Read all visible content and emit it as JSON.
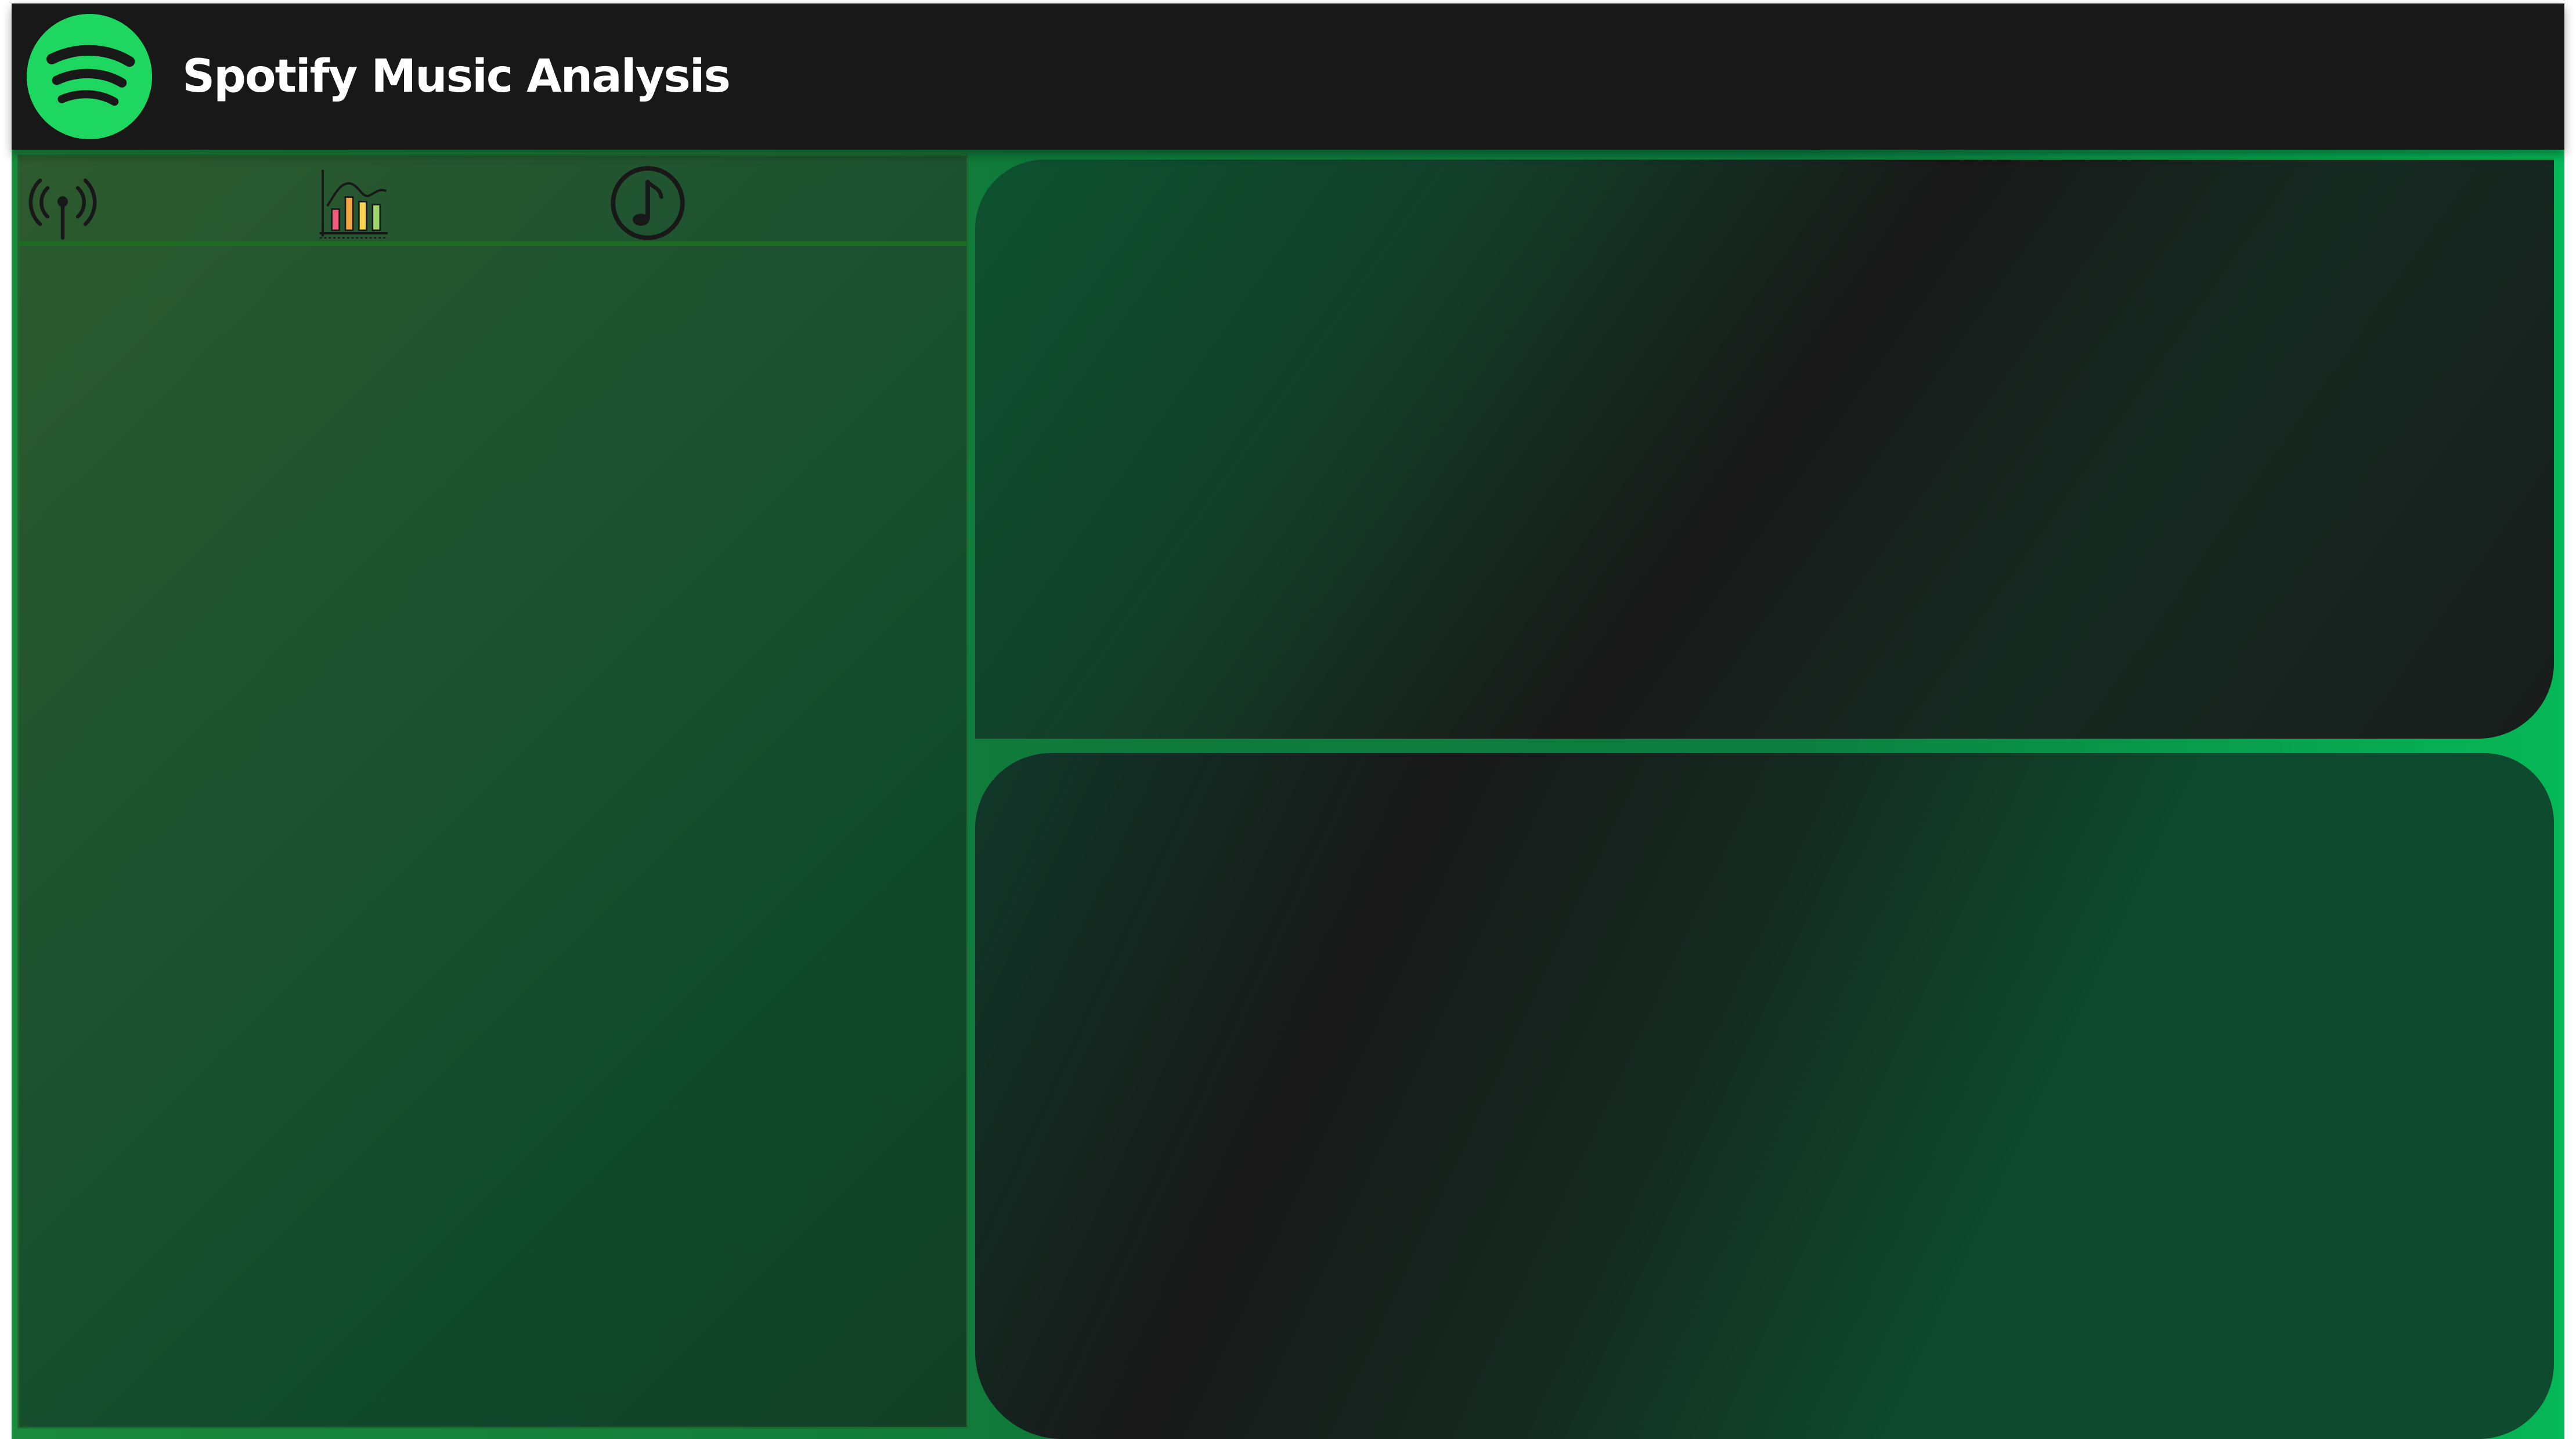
{
  "header": {
    "title": "Spotify Music Analysis",
    "logo_icon": "spotify-logo-icon"
  },
  "nav": {
    "items": [
      {
        "icon": "broadcast-antenna-icon"
      },
      {
        "icon": "bar-chart-icon"
      },
      {
        "icon": "music-note-icon"
      }
    ]
  },
  "colors": {
    "header_bg": "#181818",
    "brand_green": "#1ed760",
    "panel_green": "#1d5230",
    "accent_green": "#06b857",
    "title_text": "#ffffff"
  }
}
